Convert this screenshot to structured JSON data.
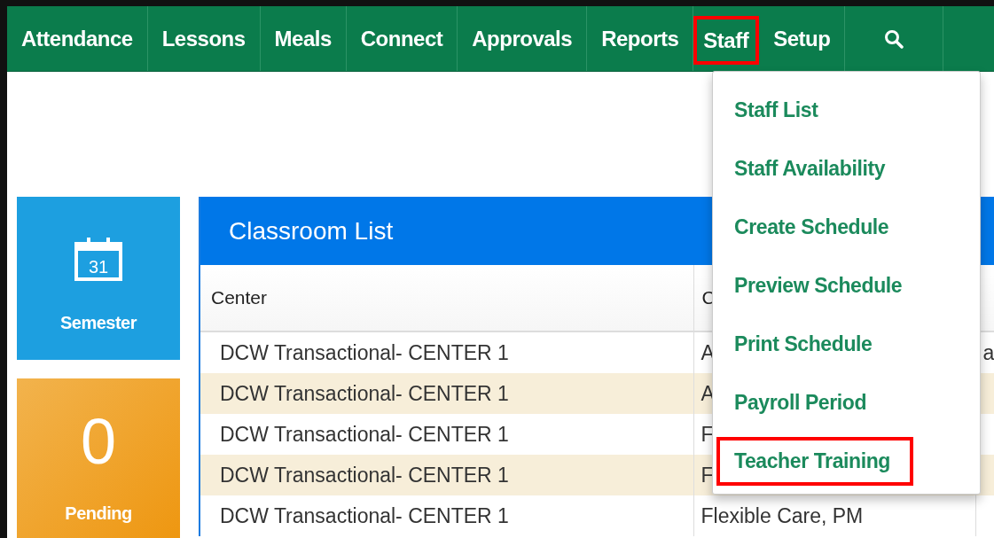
{
  "nav": {
    "items": [
      {
        "label": "Attendance",
        "highlighted": false
      },
      {
        "label": "Lessons",
        "highlighted": false
      },
      {
        "label": "Meals",
        "highlighted": false
      },
      {
        "label": "Connect",
        "highlighted": false
      },
      {
        "label": "Approvals",
        "highlighted": false
      },
      {
        "label": "Reports",
        "highlighted": false
      },
      {
        "label": "Staff",
        "highlighted": true
      },
      {
        "label": "Setup",
        "highlighted": false
      }
    ]
  },
  "staff_menu": {
    "items": [
      {
        "label": "Staff List",
        "highlighted": false
      },
      {
        "label": "Staff Availability",
        "highlighted": false
      },
      {
        "label": "Create Schedule",
        "highlighted": false
      },
      {
        "label": "Preview Schedule",
        "highlighted": false
      },
      {
        "label": "Print Schedule",
        "highlighted": false
      },
      {
        "label": "Payroll Period",
        "highlighted": false
      },
      {
        "label": "Teacher Training",
        "highlighted": true
      }
    ]
  },
  "tiles": [
    {
      "kind": "icon",
      "icon_text": "31",
      "label": "Semester"
    },
    {
      "kind": "count",
      "value": "0",
      "label": "Pending"
    }
  ],
  "classroom_list": {
    "title": "Classroom List",
    "columns": [
      "Center",
      "C"
    ],
    "rows": [
      [
        "DCW Transactional- CENTER 1",
        "A",
        "a"
      ],
      [
        "DCW Transactional- CENTER 1",
        "A"
      ],
      [
        "DCW Transactional- CENTER 1",
        "F"
      ],
      [
        "DCW Transactional- CENTER 1",
        "F"
      ],
      [
        "DCW Transactional- CENTER 1",
        "Flexible Care, PM"
      ]
    ]
  }
}
